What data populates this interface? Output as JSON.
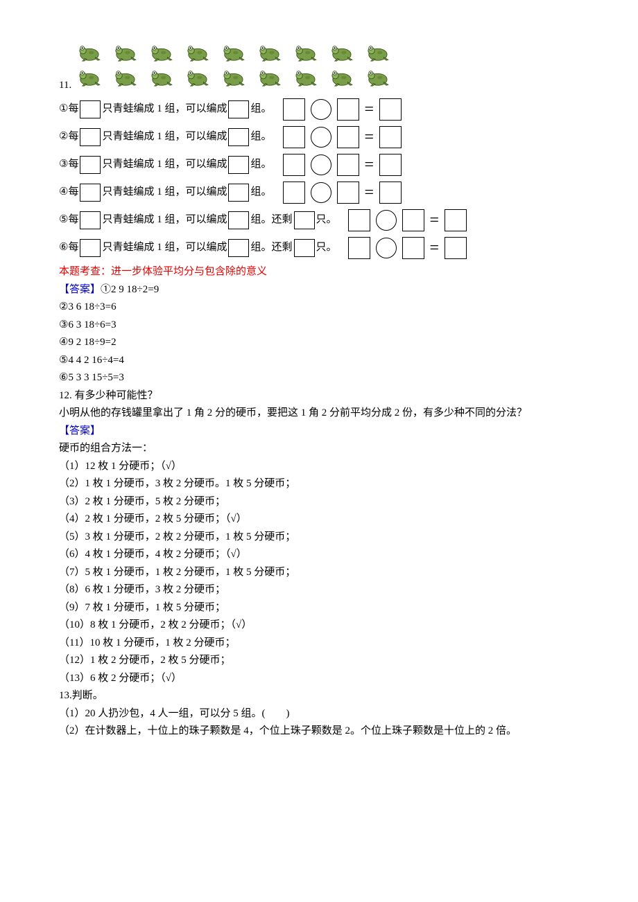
{
  "q11": {
    "number": "11.",
    "lines": [
      {
        "idx": "①",
        "t1": "每",
        "t2": "只青蛙编成 1 组，可以编成",
        "t3": "组。",
        "hasRemain": false
      },
      {
        "idx": "②",
        "t1": "每",
        "t2": "只青蛙编成 1 组，可以编成",
        "t3": "组。",
        "hasRemain": false
      },
      {
        "idx": "③",
        "t1": "每",
        "t2": "只青蛙编成 1 组，可以编成",
        "t3": "组。",
        "hasRemain": false
      },
      {
        "idx": "④",
        "t1": "每",
        "t2": "只青蛙编成 1 组，可以编成",
        "t3": "组。",
        "hasRemain": false
      },
      {
        "idx": "⑤",
        "t1": "每",
        "t2": "只青蛙编成 1 组，可以编成",
        "t3": "组。还剩",
        "t4": "只。",
        "hasRemain": true
      },
      {
        "idx": "⑥",
        "t1": "每",
        "t2": "只青蛙编成 1 组，可以编成",
        "t3": "组。还剩",
        "t4": "只。",
        "hasRemain": true
      }
    ],
    "note": "本题考查：进一步体验平均分与包含除的意义",
    "ansLabel": "【答案】",
    "answers": [
      "①2 9 18÷2=9",
      "②3 6 18÷3=6",
      "③6 3 18÷6=3",
      "④9 2 18÷9=2",
      "⑤4 4 2 16÷4=4",
      "⑥5 3 3 15÷5=3"
    ]
  },
  "q12": {
    "number": "12. ",
    "title": "有多少种可能性？",
    "body": "小明从他的存钱罐里拿出了 1 角 2 分的硬币，要把这 1 角 2 分前平均分成 2 份，有多少种不同的分法？",
    "ansLabel": "【答案】",
    "lead": "硬币的组合方法一：",
    "items": [
      "（1）12 枚 1 分硬币；（√）",
      "（2）1 枚 1 分硬币，3 枚 2 分硬币。1 枚 5 分硬币；",
      "（3）2 枚 1 分硬币，5 枚 2 分硬币；",
      "（4）2 枚 1 分硬币，2 枚 5 分硬币；（√）",
      "（5）3 枚 1 分硬币，2 枚 2 分硬币，1 枚 5 分硬币；",
      "（6）4 枚 1 分硬币，4 枚 2 分硬币；（√）",
      "（7）5 枚 1 分硬币，1 枚 2 分硬币，1 枚 5 分硬币；",
      "（8）6 枚 1 分硬币，3 枚 2 分硬币；",
      "（9）7 枚 1 分硬币，1 枚 5 分硬币；",
      "（10）8 枚 1 分硬币，2 枚 2 分硬币；（√）",
      "（11）10 枚 1 分硬币，1 枚 2 分硬币；",
      "（12）1 枚 2 分硬币，2 枚 5 分硬币；",
      "（13）6 枚 2 分硬币；（√）"
    ]
  },
  "q13": {
    "number": "13.",
    "title": "判断。",
    "items": [
      "（1）20 人扔沙包，4 人一组，可以分 5 组。(　　)",
      "（2）在计数器上，十位上的珠子颗数是 4，个位上珠子颗数是 2。个位上珠子颗数是十位上的 2 倍。"
    ]
  }
}
